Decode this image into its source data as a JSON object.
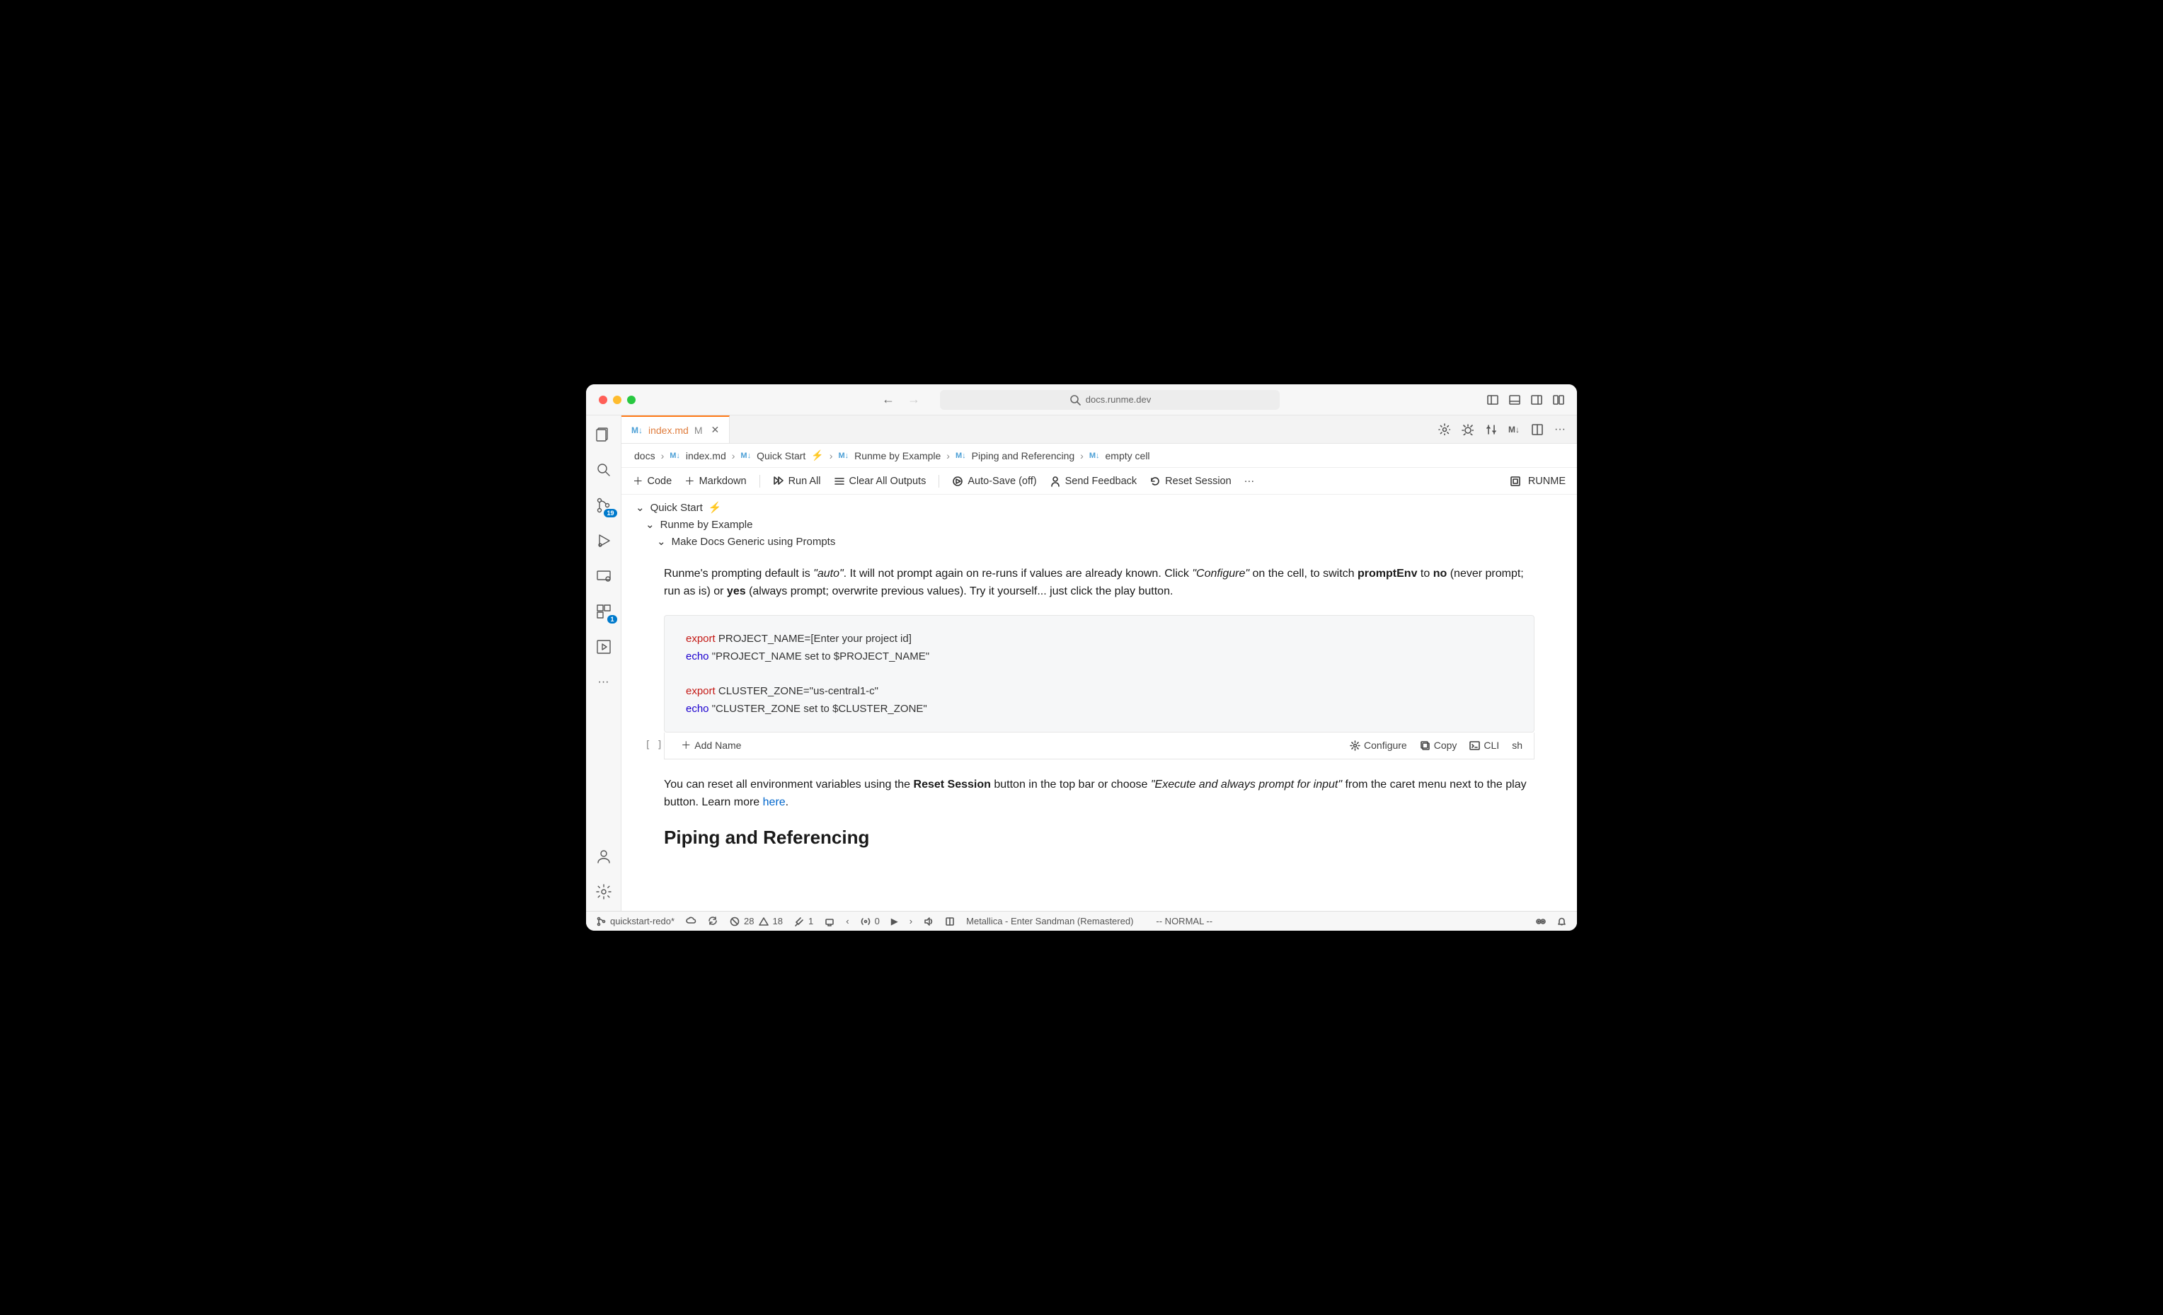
{
  "url": "docs.runme.dev",
  "tab": {
    "icon_label": "M↓",
    "name": "index.md",
    "modified": "M"
  },
  "activity_badges": {
    "scm": "19",
    "extensions": "1"
  },
  "breadcrumb": [
    {
      "text": "docs",
      "md": false
    },
    {
      "text": "index.md",
      "md": true
    },
    {
      "text": "Quick Start",
      "md": true,
      "zap": true
    },
    {
      "text": "Runme by Example",
      "md": true
    },
    {
      "text": "Piping and Referencing",
      "md": true
    },
    {
      "text": "empty cell",
      "md": true
    }
  ],
  "toolbar": {
    "code": "Code",
    "markdown": "Markdown",
    "run_all": "Run All",
    "clear": "Clear All Outputs",
    "autosave": "Auto-Save (off)",
    "feedback": "Send Feedback",
    "reset": "Reset Session",
    "brand": "RUNME"
  },
  "outline": {
    "l0": "Quick Start",
    "l1": "Runme by Example",
    "l2": "Make Docs Generic using Prompts"
  },
  "para1_a": "Runme's prompting default is ",
  "para1_b": "\"auto\"",
  "para1_c": ". It will not prompt again on re-runs if values are already known. Click ",
  "para1_d": "\"Configure\"",
  "para1_e": " on the cell, to switch ",
  "para1_f": "promptEnv",
  "para1_g": " to ",
  "para1_h": "no",
  "para1_i": " (never prompt; run as is) or ",
  "para1_j": "yes",
  "para1_k": " (always prompt; overwrite previous values). Try it yourself... just click the play button.",
  "code": {
    "l1a": "export",
    "l1b": " PROJECT_NAME=[Enter your project id]",
    "l2a": "echo",
    "l2b": " \"PROJECT_NAME set to $PROJECT_NAME\"",
    "l3a": "export",
    "l3b": " CLUSTER_ZONE=\"us-central1-c\"",
    "l4a": "echo",
    "l4b": " \"CLUSTER_ZONE set to $CLUSTER_ZONE\""
  },
  "cell_footer": {
    "brackets": "[ ]",
    "add_name": "Add Name",
    "configure": "Configure",
    "copy": "Copy",
    "cli": "CLI",
    "lang": "sh"
  },
  "para2_a": "You can reset all environment variables using the ",
  "para2_b": "Reset Session",
  "para2_c": " button in the top bar or choose ",
  "para2_d": "\"Execute and always prompt for input\"",
  "para2_e": " from the caret menu next to the play button. Learn more ",
  "para2_link": "here",
  "para2_f": ".",
  "heading": "Piping and Referencing",
  "status": {
    "branch": "quickstart-redo*",
    "errors": "28",
    "warnings": "18",
    "fix": "1",
    "radio": "0",
    "now_playing": "Metallica - Enter Sandman (Remastered)",
    "vim_mode": "-- NORMAL --"
  }
}
